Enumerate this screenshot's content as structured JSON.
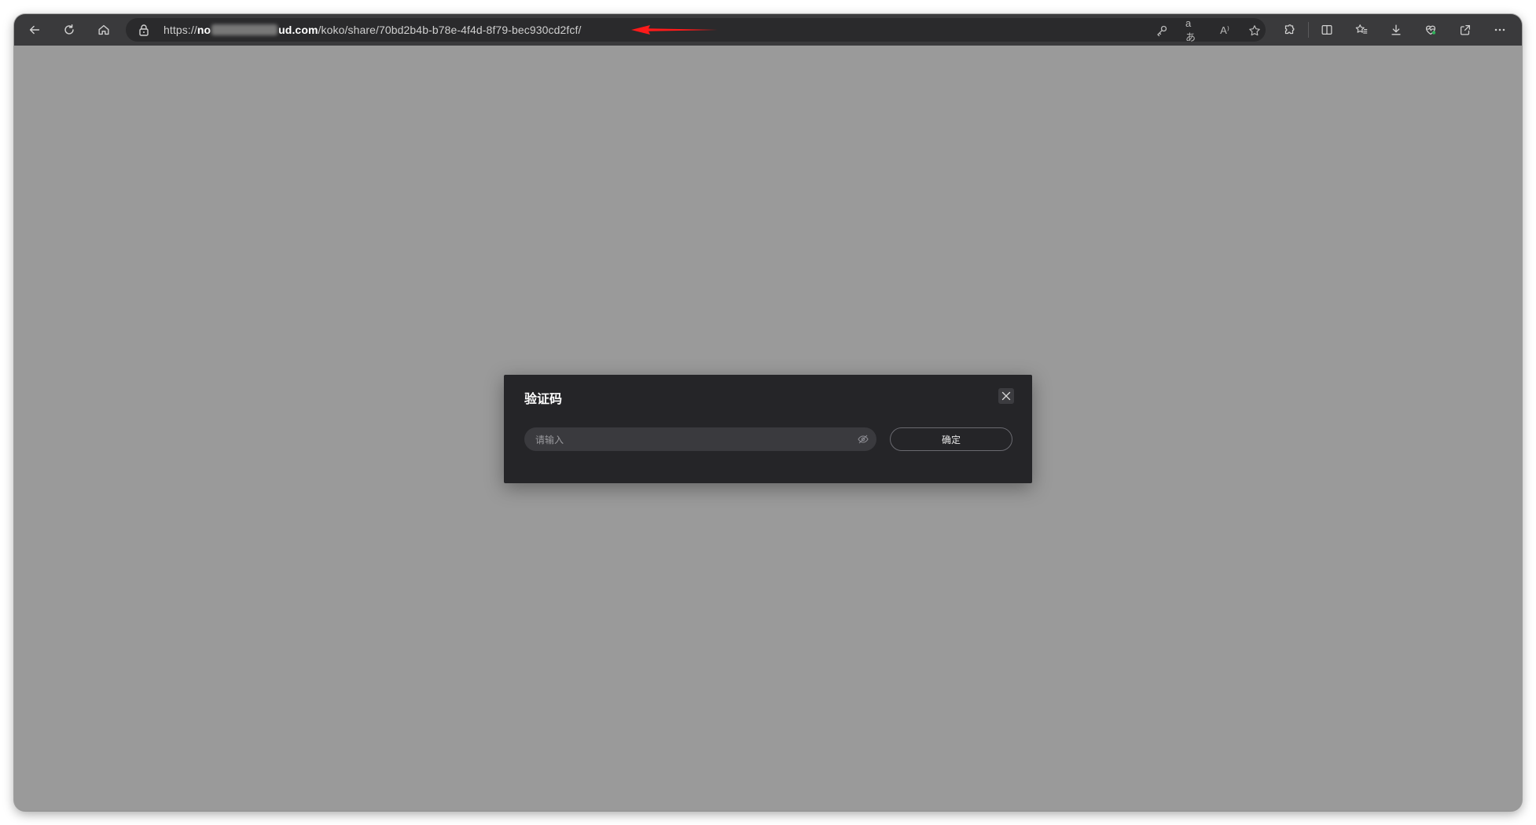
{
  "browser": {
    "url_prefix": "https://",
    "url_host_start": "no",
    "url_host_end": "ud.com",
    "url_path": "/koko/share/70bd2b4b-b78e-4f4d-8f79-bec930cd2fcf/",
    "toolbar_icons": [
      "back-arrow-icon",
      "refresh-icon",
      "home-icon",
      "lock-icon",
      "key-icon",
      "translate-icon",
      "read-aloud-icon",
      "favorite-star-icon",
      "extensions-icon",
      "split-screen-icon",
      "favorites-icon",
      "download-icon",
      "performance-heart-icon",
      "share-icon",
      "more-icon"
    ],
    "translate_glyph": "aあ",
    "read_aloud_glyph": "A⁾"
  },
  "annotation": {
    "arrow_color": "#ff1a1a"
  },
  "dialog": {
    "title": "验证码",
    "input_placeholder": "请输入",
    "confirm_label": "确定"
  },
  "colors": {
    "toolbar": "#3a3a3c",
    "overlay": "#9a9a9a",
    "dialog_bg": "#252528",
    "input_bg": "#3a3a3e"
  }
}
